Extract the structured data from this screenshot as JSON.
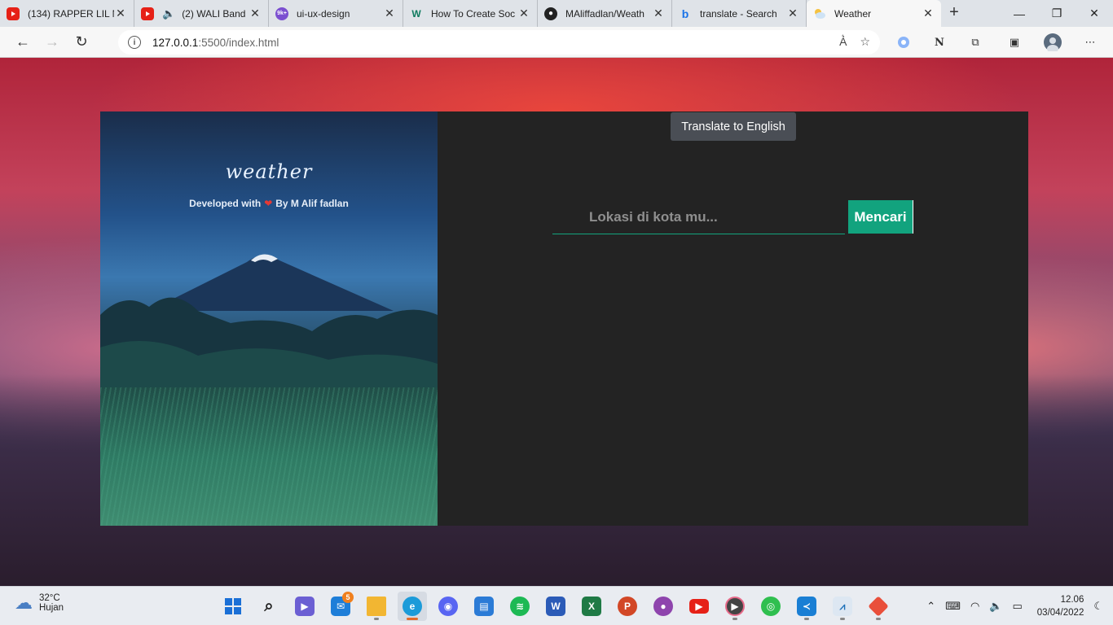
{
  "browser": {
    "tabs": [
      {
        "title": "(134) RAPPER LIL N",
        "icon": "youtube-icon",
        "audio": false
      },
      {
        "title": "(2) WALI Band",
        "icon": "youtube-icon",
        "audio": true
      },
      {
        "title": "ui-ux-design",
        "icon": "notification-icon",
        "badge": "9k+"
      },
      {
        "title": "How To Create Soc",
        "icon": "w3-icon"
      },
      {
        "title": "MAliffadlan/Weath",
        "icon": "github-icon"
      },
      {
        "title": "translate - Search",
        "icon": "bing-icon"
      },
      {
        "title": "Weather",
        "icon": "weather-icon",
        "active": true
      }
    ],
    "new_tab": "+",
    "url_host": "127.0.0.1",
    "url_path": ":5500/index.html",
    "window_controls": [
      "minimize",
      "restore",
      "close"
    ]
  },
  "tooltip": {
    "text": "Translate to English"
  },
  "hero": {
    "title": "weather",
    "subtitle_prefix": "Developed with",
    "subtitle_suffix": "By M Alif fadlan",
    "heart": "❤"
  },
  "search": {
    "placeholder": "Lokasi di kota mu...",
    "button_label": "Mencari",
    "accent": "#12a37e"
  },
  "taskbar": {
    "weather_temp": "32°C",
    "weather_text": "Hujan",
    "mail_badge": "5",
    "time": "12.06",
    "date": "03/04/2022"
  }
}
